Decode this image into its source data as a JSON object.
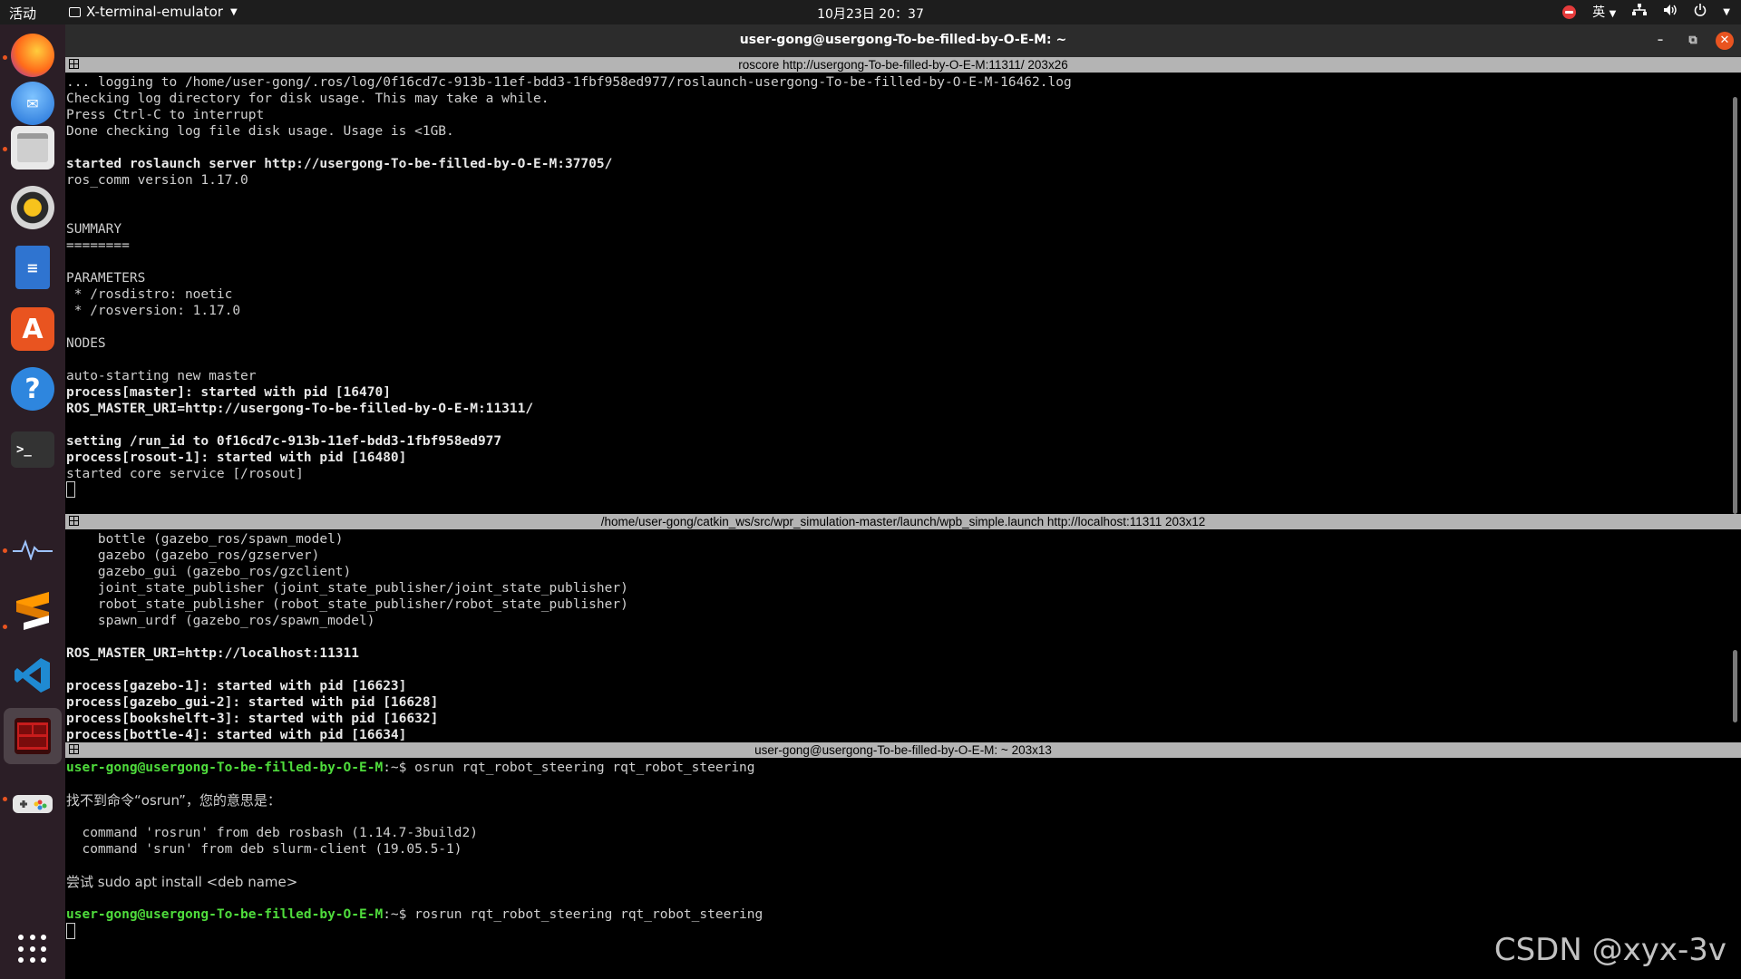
{
  "topbar": {
    "activities": "活动",
    "app_name": "X-terminal-emulator",
    "clock": "10月23日 20：37",
    "input_method": "英"
  },
  "window": {
    "title": "user-gong@usergong-To-be-filled-by-O-E-M: ~"
  },
  "panes": [
    {
      "title": "roscore http://usergong-To-be-filled-by-O-E-M:11311/ 203x26",
      "lines": [
        {
          "t": "... logging to /home/user-gong/.ros/log/0f16cd7c-913b-11ef-bdd3-1fbf958ed977/roslaunch-usergong-To-be-filled-by-O-E-M-16462.log",
          "s": ""
        },
        {
          "t": "Checking log directory for disk usage. This may take a while.",
          "s": ""
        },
        {
          "t": "Press Ctrl-C to interrupt",
          "s": ""
        },
        {
          "t": "Done checking log file disk usage. Usage is <1GB.",
          "s": ""
        },
        {
          "t": "",
          "s": ""
        },
        {
          "t": "started roslaunch server http://usergong-To-be-filled-by-O-E-M:37705/",
          "s": "b"
        },
        {
          "t": "ros_comm version 1.17.0",
          "s": ""
        },
        {
          "t": "",
          "s": ""
        },
        {
          "t": "",
          "s": ""
        },
        {
          "t": "SUMMARY",
          "s": ""
        },
        {
          "t": "========",
          "s": ""
        },
        {
          "t": "",
          "s": ""
        },
        {
          "t": "PARAMETERS",
          "s": ""
        },
        {
          "t": " * /rosdistro: noetic",
          "s": ""
        },
        {
          "t": " * /rosversion: 1.17.0",
          "s": ""
        },
        {
          "t": "",
          "s": ""
        },
        {
          "t": "NODES",
          "s": ""
        },
        {
          "t": "",
          "s": ""
        },
        {
          "t": "auto-starting new master",
          "s": ""
        },
        {
          "t": "process[master]: started with pid [16470]",
          "s": "b"
        },
        {
          "t": "ROS_MASTER_URI=http://usergong-To-be-filled-by-O-E-M:11311/",
          "s": "b"
        },
        {
          "t": "",
          "s": ""
        },
        {
          "t": "setting /run_id to 0f16cd7c-913b-11ef-bdd3-1fbf958ed977",
          "s": "b"
        },
        {
          "t": "process[rosout-1]: started with pid [16480]",
          "s": "b"
        },
        {
          "t": "started core service [/rosout]",
          "s": ""
        }
      ]
    },
    {
      "title": "/home/user-gong/catkin_ws/src/wpr_simulation-master/launch/wpb_simple.launch http://localhost:11311 203x12",
      "lines": [
        {
          "t": "    bottle (gazebo_ros/spawn_model)",
          "s": ""
        },
        {
          "t": "    gazebo (gazebo_ros/gzserver)",
          "s": ""
        },
        {
          "t": "    gazebo_gui (gazebo_ros/gzclient)",
          "s": ""
        },
        {
          "t": "    joint_state_publisher (joint_state_publisher/joint_state_publisher)",
          "s": ""
        },
        {
          "t": "    robot_state_publisher (robot_state_publisher/robot_state_publisher)",
          "s": ""
        },
        {
          "t": "    spawn_urdf (gazebo_ros/spawn_model)",
          "s": ""
        },
        {
          "t": "",
          "s": ""
        },
        {
          "t": "ROS_MASTER_URI=http://localhost:11311",
          "s": "b"
        },
        {
          "t": "",
          "s": ""
        },
        {
          "t": "process[gazebo-1]: started with pid [16623]",
          "s": "b"
        },
        {
          "t": "process[gazebo_gui-2]: started with pid [16628]",
          "s": "b"
        },
        {
          "t": "process[bookshelft-3]: started with pid [16632]",
          "s": "b"
        },
        {
          "t": "process[bottle-4]: started with pid [16634]",
          "s": "b"
        }
      ]
    },
    {
      "title": "user-gong@usergong-To-be-filled-by-O-E-M: ~ 203x13",
      "prompt": "user-gong@usergong-To-be-filled-by-O-E-M",
      "prompt_suffix": ":~$ ",
      "cmd1": "osrun rqt_robot_steering rqt_robot_steering",
      "lines": [
        "找不到命令“osrun”，您的意思是：",
        "",
        "  command 'rosrun' from deb rosbash (1.14.7-3build2)",
        "  command 'srun' from deb slurm-client (19.05.5-1)",
        "",
        "尝试 sudo apt install <deb name>",
        ""
      ],
      "cmd2": "rosrun rqt_robot_steering rqt_robot_steering"
    }
  ],
  "watermark": "CSDN @xyx-3v",
  "dock": {
    "items": [
      "firefox-icon",
      "thunderbird-icon",
      "files-icon",
      "rhythmbox-icon",
      "writer-icon",
      "software-icon",
      "help-icon",
      "terminal-icon",
      "system-monitor-icon",
      "sublime-icon",
      "vscode-icon",
      "terminator-icon",
      "game-icon",
      "show-apps-icon"
    ]
  }
}
